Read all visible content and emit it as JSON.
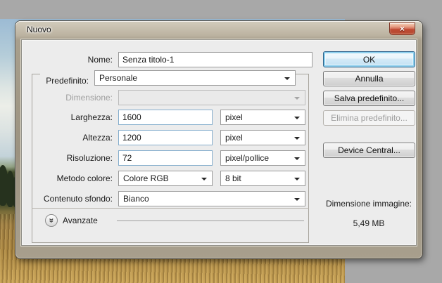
{
  "dialog": {
    "title": "Nuovo",
    "close_glyph": "×",
    "fields": {
      "name": {
        "label": "Nome:",
        "value": "Senza titolo-1"
      },
      "preset": {
        "label": "Predefinito:",
        "value": "Personale"
      },
      "size": {
        "label": "Dimensione:",
        "value": ""
      },
      "width": {
        "label": "Larghezza:",
        "value": "1600",
        "unit": "pixel"
      },
      "height": {
        "label": "Altezza:",
        "value": "1200",
        "unit": "pixel"
      },
      "resolution": {
        "label": "Risoluzione:",
        "value": "72",
        "unit": "pixel/pollice"
      },
      "color_mode": {
        "label": "Metodo colore:",
        "value": "Colore RGB",
        "depth": "8 bit"
      },
      "background_contents": {
        "label": "Contenuto sfondo:",
        "value": "Bianco"
      }
    },
    "advanced": {
      "label": "Avanzate",
      "toggle_glyph": "»"
    },
    "buttons": {
      "ok": "OK",
      "cancel": "Annulla",
      "save_preset": "Salva predefinito...",
      "delete_preset": "Elimina predefinito...",
      "device_central": "Device Central..."
    },
    "image_size": {
      "label": "Dimensione immagine:",
      "value": "5,49 MB"
    }
  },
  "icons": {
    "close": "close-x",
    "advanced_toggle": "chevron-double-down",
    "combo": "caret-down"
  },
  "colors": {
    "app_background": "#a8a8a8",
    "dialog_frame": "#a89f8c",
    "client_background": "#ececec",
    "close_button_red": "#bf4a32",
    "ok_focus_glow": "#8ed0ee",
    "focused_field_border": "#85aecd"
  }
}
